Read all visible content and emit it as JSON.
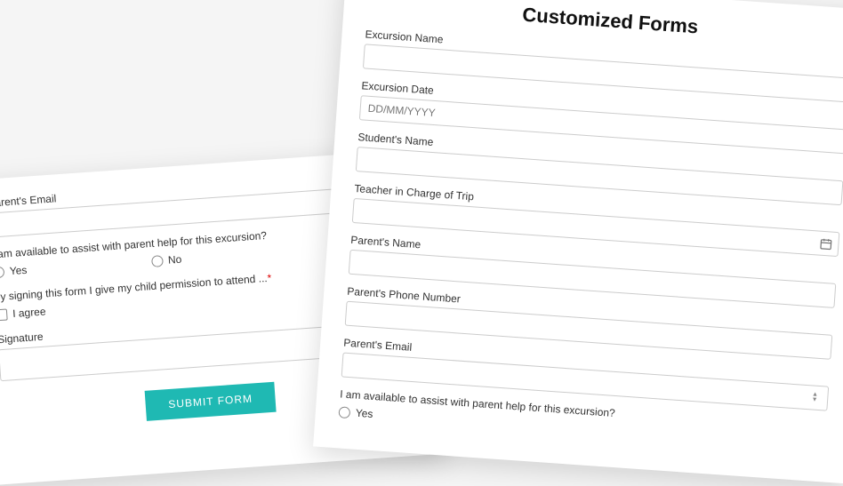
{
  "back": {
    "email_label": "Parent's Email",
    "assist_q": "I am available to assist with parent help for this excursion?",
    "yes": "Yes",
    "no": "No",
    "permission_q": "by signing this form I give my child permission to attend ...",
    "agree": "I agree",
    "signature_label": "Signature",
    "submit": "SUBMIT FORM"
  },
  "front": {
    "title": "Customized Forms",
    "excursion_name": "Excursion Name",
    "excursion_date": "Excursion Date",
    "date_placeholder": "DD/MM/YYYY",
    "student_name": "Student's Name",
    "teacher": "Teacher in Charge of Trip",
    "parent_name": "Parent's Name",
    "parent_phone": "Parent's Phone Number",
    "parent_email": "Parent's Email",
    "assist_q": "I am available to assist with parent help for this excursion?",
    "yes": "Yes"
  }
}
